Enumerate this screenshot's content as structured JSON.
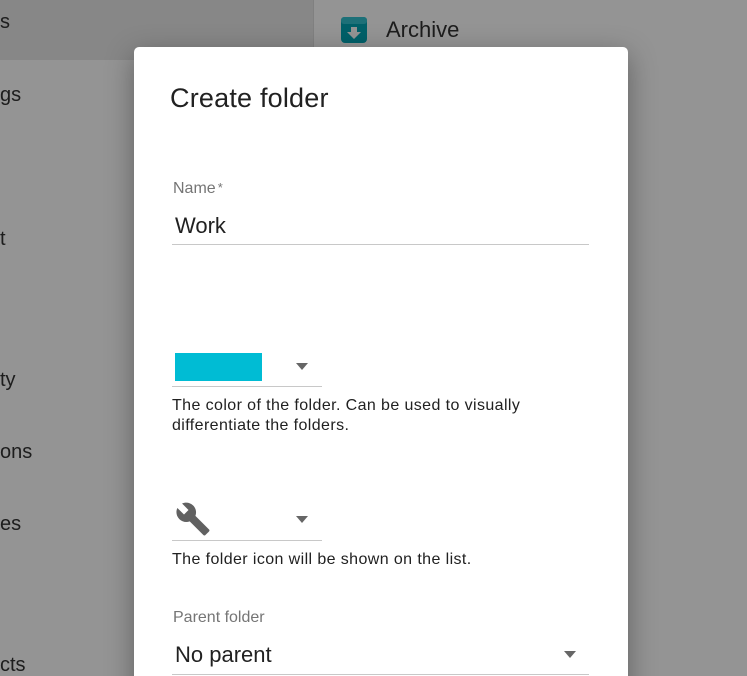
{
  "background": {
    "sidebar_fragments": [
      "s",
      "gs",
      "t",
      "ty",
      "ons",
      "es",
      "cts"
    ],
    "main_item": {
      "label": "Archive",
      "icon": "archive-download-icon",
      "icon_color": "#00a5b5"
    }
  },
  "dialog": {
    "title": "Create folder",
    "name_field": {
      "label": "Name",
      "required_mark": "*",
      "value": "Work"
    },
    "color_field": {
      "selected_color": "#00bcd4",
      "helper_text": "The color of the folder. Can be used to visually differentiate the folders."
    },
    "icon_field": {
      "selected_icon": "wrench-icon",
      "helper_text": "The folder icon will be shown on the list."
    },
    "parent_field": {
      "label": "Parent folder",
      "value": "No parent"
    }
  }
}
